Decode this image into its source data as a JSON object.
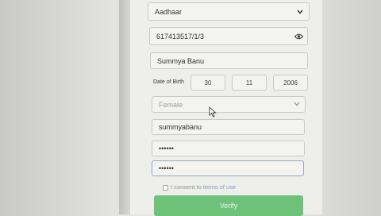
{
  "form": {
    "id_type": {
      "value": "Aadhaar"
    },
    "id_number": {
      "value": "617413517/1/3"
    },
    "full_name": {
      "value": "Summya Banu"
    },
    "dob": {
      "label": "Date of Birth",
      "day": "30",
      "month": "11",
      "year": "2006"
    },
    "gender": {
      "value": "Female"
    },
    "username": {
      "value": "summyabanu"
    },
    "password": {
      "value": "••••••"
    },
    "confirm_password": {
      "value": "••••••"
    },
    "consent": {
      "text": "I consent to",
      "link": "terms of use"
    },
    "submit_label": "Verify"
  },
  "icons": {
    "select_arrow": "chevron-down-icon",
    "reveal": "eye-icon",
    "cursor": "mouse-pointer-icon"
  },
  "colors": {
    "button": "#6fc27a",
    "link": "#7f9bc7"
  }
}
